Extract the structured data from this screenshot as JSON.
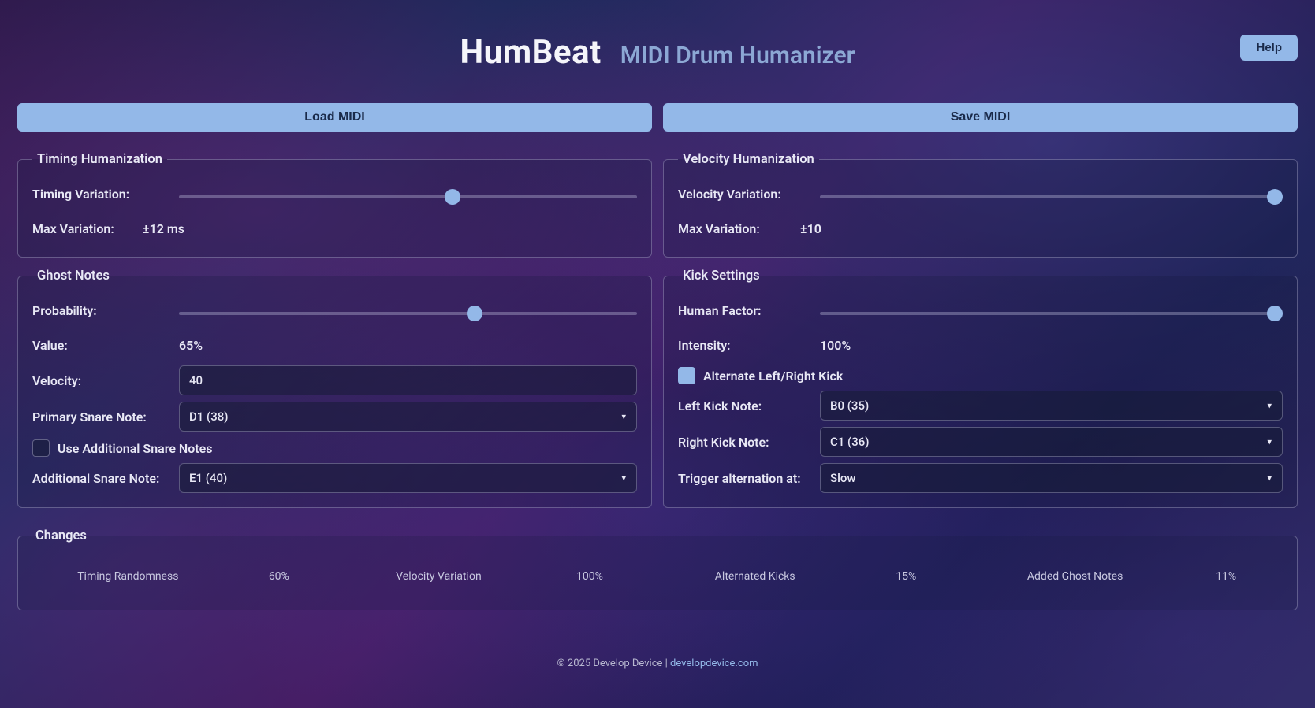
{
  "header": {
    "title": "HumBeat",
    "subtitle": "MIDI Drum Humanizer",
    "help": "Help"
  },
  "buttons": {
    "load": "Load MIDI",
    "save": "Save MIDI"
  },
  "timing": {
    "legend": "Timing Humanization",
    "variation_label": "Timing Variation:",
    "variation_pct": 60,
    "max_label": "Max Variation:",
    "max_value": "±12 ms"
  },
  "velocity": {
    "legend": "Velocity Humanization",
    "variation_label": "Velocity Variation:",
    "variation_pct": 100,
    "max_label": "Max Variation:",
    "max_value": "±10"
  },
  "ghost": {
    "legend": "Ghost Notes",
    "probability_label": "Probability:",
    "probability_pct": 65,
    "value_label": "Value:",
    "value_value": "65%",
    "velocity_label": "Velocity:",
    "velocity_value": "40",
    "primary_label": "Primary Snare Note:",
    "primary_value": "D1 (38)",
    "use_additional_label": "Use Additional Snare Notes",
    "use_additional_checked": false,
    "additional_label": "Additional Snare Note:",
    "additional_value": "E1 (40)"
  },
  "kick": {
    "legend": "Kick Settings",
    "human_label": "Human Factor:",
    "human_pct": 100,
    "intensity_label": "Intensity:",
    "intensity_value": "100%",
    "alternate_label": "Alternate Left/Right Kick",
    "alternate_checked": true,
    "left_label": "Left Kick Note:",
    "left_value": "B0 (35)",
    "right_label": "Right Kick Note:",
    "right_value": "C1 (36)",
    "trigger_label": "Trigger alternation at:",
    "trigger_value": "Slow"
  },
  "changes": {
    "legend": "Changes",
    "stats": [
      {
        "label": "Timing Randomness",
        "value": "60%"
      },
      {
        "label": "Velocity Variation",
        "value": "100%"
      },
      {
        "label": "Alternated Kicks",
        "value": "15%"
      },
      {
        "label": "Added Ghost Notes",
        "value": "11%"
      }
    ]
  },
  "footer": {
    "copyright": "© 2025 Develop Device | ",
    "link_text": "developdevice.com"
  }
}
